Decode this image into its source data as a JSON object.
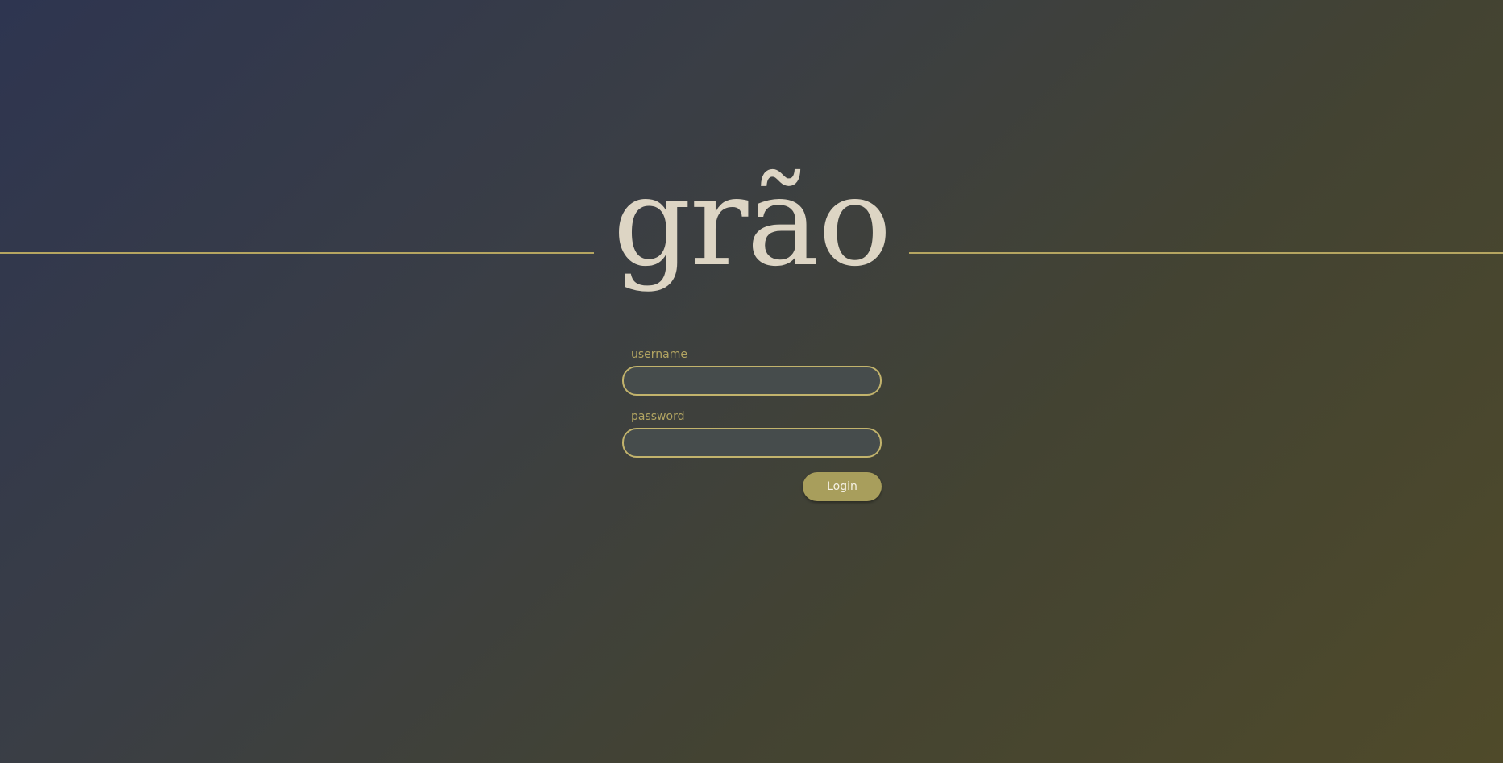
{
  "brand": {
    "logo_text": "grão"
  },
  "login_form": {
    "username": {
      "label": "username",
      "value": "",
      "placeholder": ""
    },
    "password": {
      "label": "password",
      "value": "",
      "placeholder": ""
    },
    "submit_label": "Login"
  },
  "colors": {
    "accent": "#b5a561",
    "logo": "#ddd5c4",
    "button": "#a89e5c",
    "input_background": "#464c4c"
  }
}
